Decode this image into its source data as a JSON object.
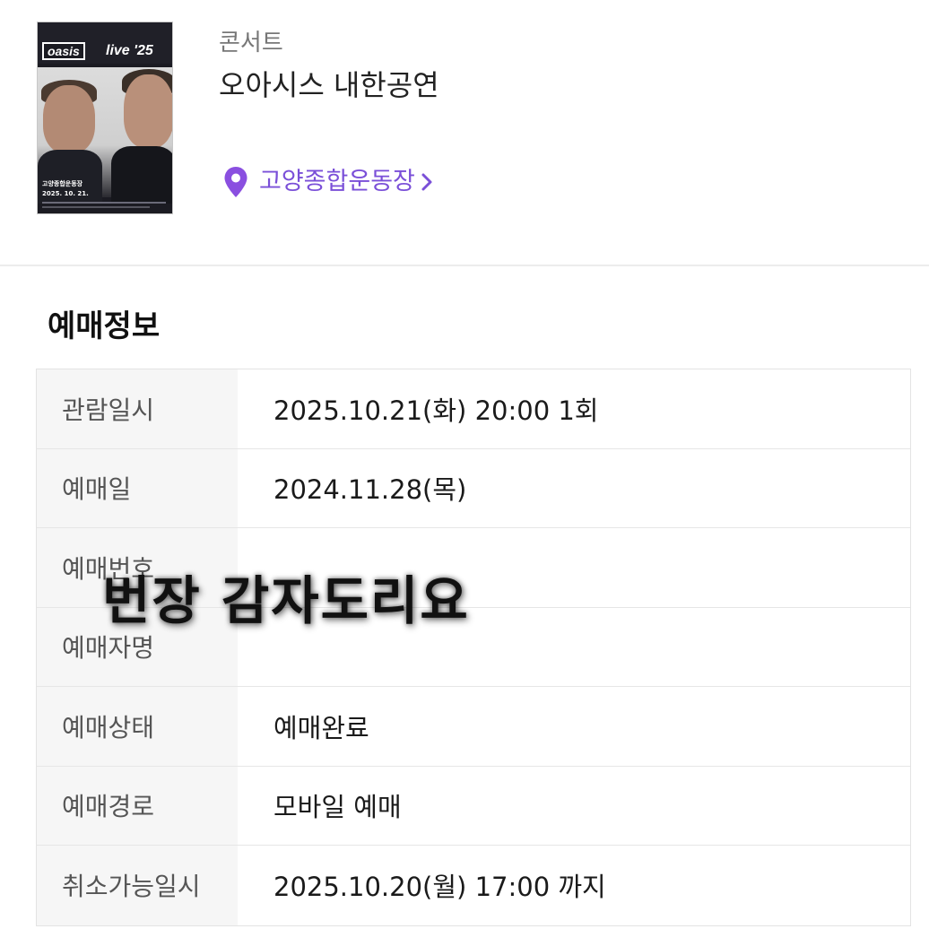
{
  "poster": {
    "logo_text": "oasis",
    "live_text": "live '25",
    "venue_text": "고양종합운동장",
    "date_text": "2025. 10. 21."
  },
  "header": {
    "category": "콘서트",
    "title": "오아시스 내한공연",
    "venue": "고양종합운동장"
  },
  "section": {
    "title": "예매정보"
  },
  "info_rows": [
    {
      "label": "관람일시",
      "value": "2025.10.21(화) 20:00 1회"
    },
    {
      "label": "예매일",
      "value": "2024.11.28(목)"
    },
    {
      "label": "예매번호",
      "value": ""
    },
    {
      "label": "예매자명",
      "value": ""
    },
    {
      "label": "예매상태",
      "value": "예매완료"
    },
    {
      "label": "예매경로",
      "value": "모바일 예매"
    },
    {
      "label": "취소가능일시",
      "value": "2025.10.20(월) 17:00 까지"
    }
  ],
  "overlay": {
    "text": "번장 감자도리요"
  },
  "colors": {
    "accent": "#7a4fd8",
    "label_bg": "#f6f6f6",
    "border": "#e3e3e3"
  },
  "icons": {
    "venue": "location-pin-icon",
    "venue_arrow": "chevron-right-icon"
  }
}
